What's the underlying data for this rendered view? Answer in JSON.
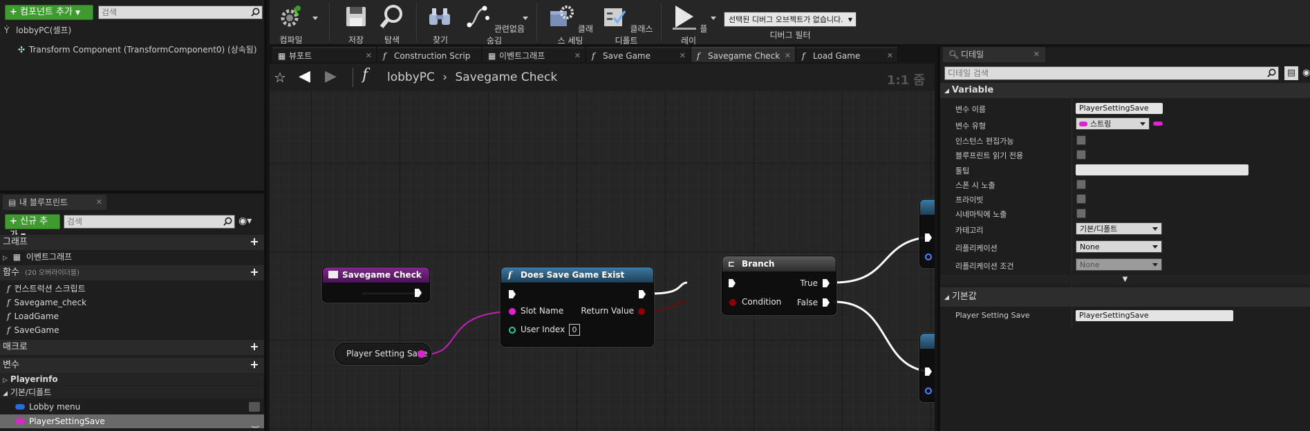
{
  "components": {
    "add_button": "컴포넌트 추가",
    "search_placeholder": "검색",
    "root_item": "lobbyPC(셀프)",
    "child_item": "Transform Component (TransformComponent0) (상속됨)"
  },
  "my_blueprint": {
    "tab_label": "내 블루프린트",
    "new_button": "신규 추가",
    "search_placeholder": "검색",
    "categories": {
      "graph": "그래프",
      "event_graph": "이벤트그래프",
      "functions": "함수",
      "functions_override": "(20 오버라이더블)",
      "macros": "매크로",
      "variables": "변수"
    },
    "function_items": [
      "컨스트럭션 스크립트",
      "Savegame_check",
      "LoadGame",
      "SaveGame"
    ],
    "variable_groups": {
      "playerinfo": "Playerinfo",
      "default": "기본/디폴트"
    },
    "variable_items": [
      "Lobby menu",
      "PlayerSettingSave"
    ]
  },
  "toolbar": {
    "compile": "컴파일",
    "save": "저장",
    "browse": "탐색",
    "find": "찾기",
    "hide_unrelated": "관련없음 숨김",
    "class_settings": "클래스 세팅",
    "class_defaults": "클래스 디폴트",
    "play": "플레이",
    "debug_object": "선택된 디버그 오브젝트가 없습니다.",
    "debug_filter": "디버그 필터"
  },
  "tabs": [
    "뷰포트",
    "Construction Scrip",
    "이벤트그래프",
    "Save Game",
    "Savegame Check",
    "Load Game"
  ],
  "graph": {
    "breadcrumb_root": "lobbyPC",
    "breadcrumb_current": "Savegame Check",
    "zoom": "1:1 줌",
    "nodes": {
      "entry": "Savegame Check",
      "does_save": "Does Save Game Exist",
      "slot_name": "Slot Name",
      "return_value": "Return Value",
      "user_index": "User Index",
      "user_index_value": "0",
      "branch": "Branch",
      "condition": "Condition",
      "true": "True",
      "false": "False",
      "variable": "Player Setting Save"
    }
  },
  "details": {
    "tab_label": "디테일",
    "search_placeholder": "디테일 검색",
    "variable_section": "Variable",
    "rows": {
      "var_name_label": "변수 이름",
      "var_name_value": "PlayerSettingSave",
      "var_type_label": "변수 유형",
      "var_type_value": "스트링",
      "instance_editable": "인스턴스 편집가능",
      "blueprint_readonly": "블루프린트 읽기 전용",
      "tooltip": "툴팁",
      "expose_spawn": "스폰 시 노출",
      "private": "프라이빗",
      "expose_cinematics": "시네마틱에 노출",
      "category_label": "카테고리",
      "category_value": "기본/디폴트",
      "replication_label": "리플리케이션",
      "replication_value": "None",
      "rep_condition_label": "리플리케이션 조건",
      "rep_condition_value": "None"
    },
    "default_section": "기본값",
    "default_label": "Player Setting Save",
    "default_value": "PlayerSettingSave"
  },
  "colors": {
    "string_pin": "#e022d0",
    "bool_pin": "#8c0000",
    "exec": "#ffffff",
    "function_header": "#2c5a78",
    "entry_header": "#6d1878"
  }
}
